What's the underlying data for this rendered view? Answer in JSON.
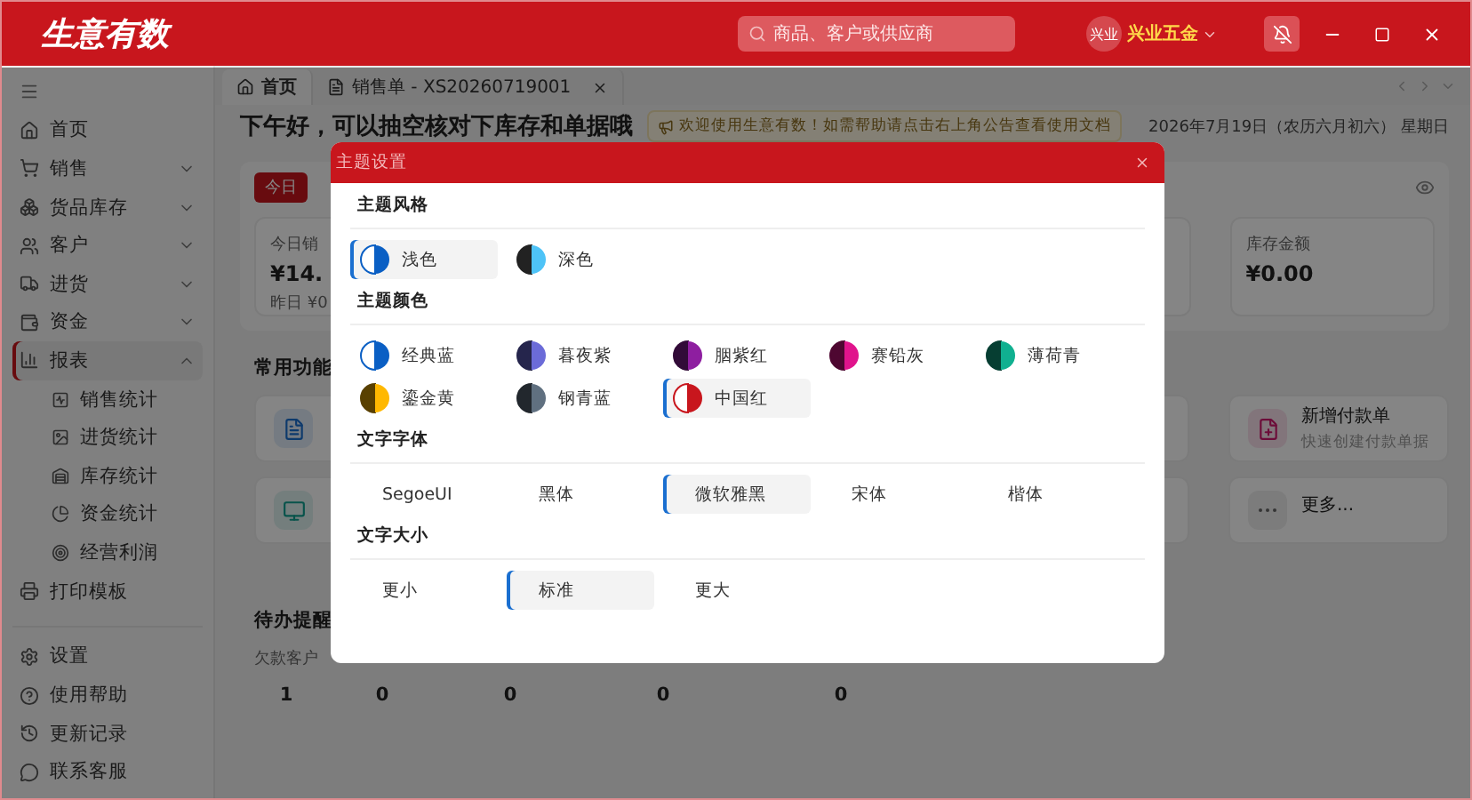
{
  "app": {
    "logo": "生意有数",
    "search": {
      "placeholder": "商品、客户或供应商"
    },
    "user": {
      "avatar": "兴业",
      "name": "兴业五金"
    }
  },
  "sidebar": {
    "items": [
      {
        "label": "首页",
        "selected": false
      },
      {
        "label": "销售",
        "expanded": false,
        "selected": false
      },
      {
        "label": "货品库存",
        "expanded": false,
        "selected": false
      },
      {
        "label": "客户",
        "expanded": false,
        "selected": false
      },
      {
        "label": "进货",
        "expanded": false,
        "selected": false
      },
      {
        "label": "资金",
        "expanded": false,
        "selected": false
      },
      {
        "label": "报表",
        "expanded": true,
        "selected": true,
        "children": [
          {
            "label": "销售统计"
          },
          {
            "label": "进货统计"
          },
          {
            "label": "库存统计"
          },
          {
            "label": "资金统计"
          },
          {
            "label": "经营利润"
          }
        ]
      },
      {
        "label": "打印模板",
        "selected": false
      }
    ],
    "bottom": [
      {
        "label": "设置"
      },
      {
        "label": "使用帮助"
      },
      {
        "label": "更新记录"
      },
      {
        "label": "联系客服"
      }
    ]
  },
  "tabs": [
    {
      "label": "首页",
      "selected": true
    },
    {
      "label": "销售单 - XS20260719001",
      "selected": false
    }
  ],
  "home": {
    "greeting": "下午好，可以抽空核对下库存和单据哦",
    "notice": "欢迎使用生意有数！如需帮助请点击右上角公告查看使用文档",
    "date": "2026年7月19日（农历六月初六） 星期日",
    "period": "今日",
    "stats": [
      {
        "label": "今日销",
        "value": "¥14.",
        "compare": "昨日 ¥0"
      },
      {
        "label": "库存金额",
        "value": "¥0.00"
      }
    ],
    "quick_title": "常用功能",
    "quick": [
      {
        "kind": "icon-only"
      },
      {
        "kind": "card",
        "title": "新增付款单",
        "subtitle": "快速创建付款单据"
      },
      {
        "kind": "icon-only"
      },
      {
        "kind": "more",
        "title": "更多..."
      }
    ],
    "todo_title": "待办提醒",
    "todo_label": "欠款客户",
    "todo_values": [
      "1",
      "0",
      "0",
      "0",
      "0"
    ]
  },
  "dialog": {
    "title": "主题设置",
    "sections": [
      {
        "title": "主题风格",
        "kind": "swatch",
        "options": [
          {
            "label": "浅色",
            "selected": true,
            "kind": "outline",
            "color": "#0a5fc4"
          },
          {
            "label": "深色",
            "selected": false,
            "kind": "dark",
            "color": "#4ec3f7"
          }
        ]
      },
      {
        "title": "主题颜色",
        "kind": "swatch",
        "options": [
          {
            "label": "经典蓝",
            "selected": false,
            "kind": "outline",
            "color": "#0a5fc4"
          },
          {
            "label": "暮夜紫",
            "selected": false,
            "kind": "split",
            "color": "#6b6bd8"
          },
          {
            "label": "胭紫红",
            "selected": false,
            "kind": "split",
            "color": "#8e1ea0"
          },
          {
            "label": "赛铅灰",
            "selected": false,
            "kind": "split",
            "color": "#e0148c"
          },
          {
            "label": "薄荷青",
            "selected": false,
            "kind": "split",
            "color": "#10b090"
          },
          {
            "label": "鎏金黄",
            "selected": false,
            "kind": "split",
            "color": "#ffb800"
          },
          {
            "label": "钢青蓝",
            "selected": false,
            "kind": "split",
            "color": "#607080"
          },
          {
            "label": "中国红",
            "selected": true,
            "kind": "outline",
            "color": "#c8161d"
          }
        ]
      },
      {
        "title": "文字字体",
        "kind": "text",
        "options": [
          {
            "label": "SegoeUI",
            "selected": false
          },
          {
            "label": "黑体",
            "selected": false
          },
          {
            "label": "微软雅黑",
            "selected": true
          },
          {
            "label": "宋体",
            "selected": false
          },
          {
            "label": "楷体",
            "selected": false
          }
        ]
      },
      {
        "title": "文字大小",
        "kind": "text",
        "options": [
          {
            "label": "更小",
            "selected": false
          },
          {
            "label": "标准",
            "selected": true
          },
          {
            "label": "更大",
            "selected": false
          }
        ]
      }
    ]
  }
}
